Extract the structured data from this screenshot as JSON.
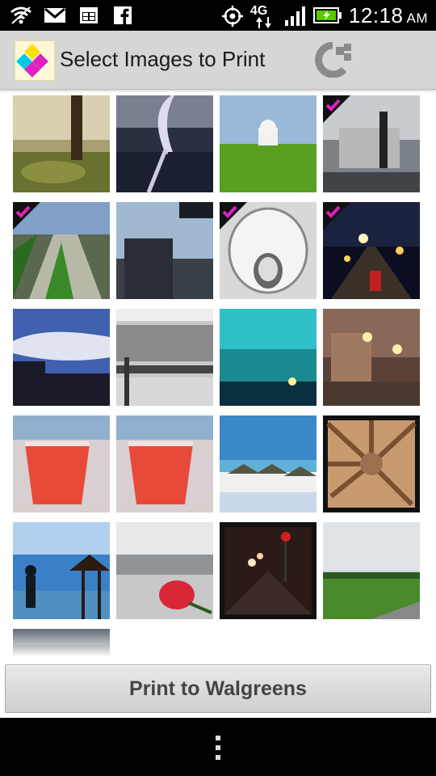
{
  "status_bar": {
    "network_label": "4G",
    "time": "12:18",
    "ampm": "AM",
    "icons": [
      "wifi-icon",
      "gmail-icon",
      "calendar-icon",
      "facebook-icon",
      "gps-icon",
      "4g-lte-icon",
      "signal-icon",
      "battery-charging-icon"
    ]
  },
  "action_bar": {
    "title": "Select Images to Print",
    "logo_icon": "app-logo-icon",
    "brand_icon": "walgreens-w-icon"
  },
  "images": [
    {
      "name": "park-tree",
      "selected": false
    },
    {
      "name": "fountain",
      "selected": false
    },
    {
      "name": "capitol-lawn",
      "selected": false
    },
    {
      "name": "building-plaza",
      "selected": true
    },
    {
      "name": "cascade-garden",
      "selected": true
    },
    {
      "name": "dusk-buildings",
      "selected": false
    },
    {
      "name": "sculpture",
      "selected": true
    },
    {
      "name": "night-street",
      "selected": true
    },
    {
      "name": "cloudy-sunset",
      "selected": false
    },
    {
      "name": "snowy-street",
      "selected": false
    },
    {
      "name": "teal-sky-lights",
      "selected": false
    },
    {
      "name": "street-lamps",
      "selected": false
    },
    {
      "name": "red-drink-1",
      "selected": false
    },
    {
      "name": "red-drink-2",
      "selected": false
    },
    {
      "name": "beach-umbrellas",
      "selected": false
    },
    {
      "name": "palapa-roof",
      "selected": false
    },
    {
      "name": "beach-silhouette",
      "selected": false
    },
    {
      "name": "rose-sand",
      "selected": false
    },
    {
      "name": "night-road",
      "selected": false
    },
    {
      "name": "green-field",
      "selected": false
    },
    {
      "name": "dark-horizon",
      "selected": false
    }
  ],
  "colors": {
    "accent_check": "#e020c0",
    "action_bar_bg": "#d6d6d6"
  },
  "print_button": {
    "label": "Print to Walgreens"
  },
  "nav_bar": {
    "menu_icon": "overflow-menu-icon"
  }
}
